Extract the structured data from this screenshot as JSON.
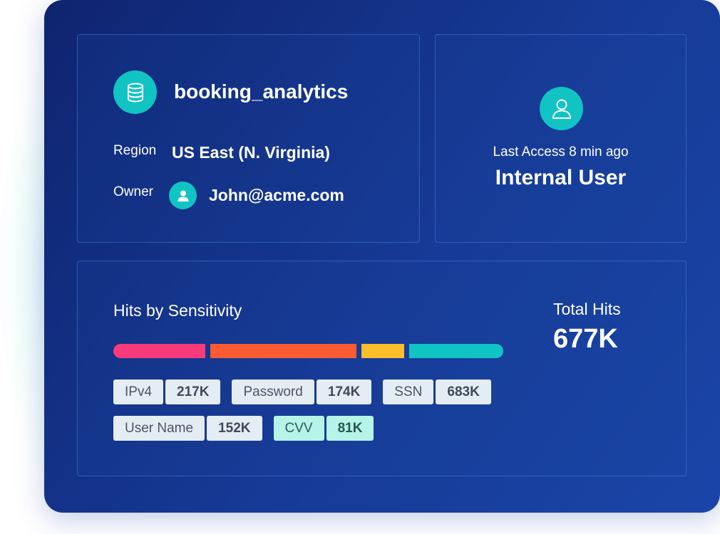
{
  "database": {
    "name": "booking_analytics",
    "region_label": "Region",
    "region_value": "US East (N. Virginia)",
    "owner_label": "Owner",
    "owner_value": "John@acme.com",
    "icon": "database-icon",
    "owner_icon": "user-icon"
  },
  "user_card": {
    "icon": "user-outline-icon",
    "last_access": "Last Access 8 min ago",
    "user_type": "Internal User"
  },
  "hits": {
    "title": "Hits by Sensitivity",
    "total_label": "Total Hits",
    "total_value": "677K",
    "bar_segments": [
      {
        "color": "#fb3a7a",
        "fraction": 0.245
      },
      {
        "color": "#ff5b32",
        "fraction": 0.39
      },
      {
        "color": "#fbbe2c",
        "fraction": 0.115
      },
      {
        "color": "#11c4c4",
        "fraction": 0.25
      }
    ],
    "tag_rows": [
      [
        {
          "label": "IPv4",
          "count": "217K",
          "style": "default"
        },
        {
          "label": "Password",
          "count": "174K",
          "style": "default"
        },
        {
          "label": "SSN",
          "count": "683K",
          "style": "default"
        }
      ],
      [
        {
          "label": "User Name",
          "count": "152K",
          "style": "default"
        },
        {
          "label": "CVV",
          "count": "81K",
          "style": "teal"
        }
      ]
    ]
  },
  "colors": {
    "accent": "#12c3c3",
    "panel_bg": "#163a96"
  }
}
